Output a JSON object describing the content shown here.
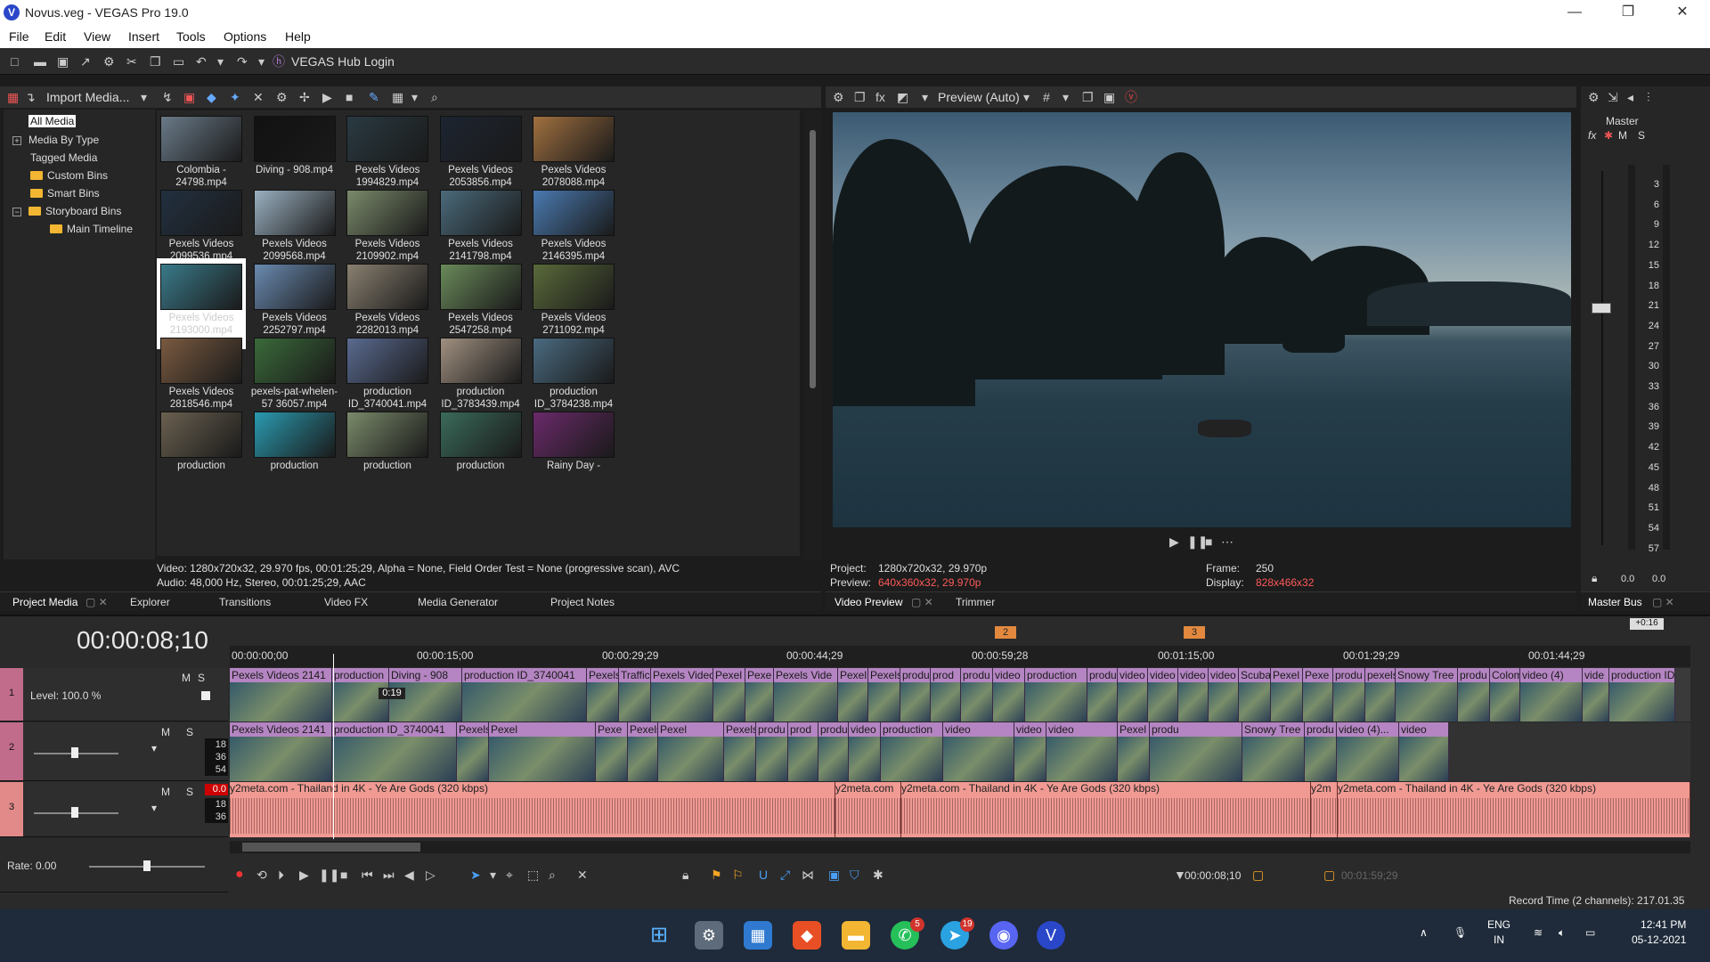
{
  "window": {
    "title": "Novus.veg - VEGAS Pro 19.0",
    "minimize": "—",
    "maximize": "❐",
    "close": "✕"
  },
  "menu": [
    "File",
    "Edit",
    "View",
    "Insert",
    "Tools",
    "Options",
    "Help"
  ],
  "toolbar": {
    "hub_login": "VEGAS Hub Login"
  },
  "media": {
    "import_label": "Import Media...",
    "tree": [
      "All Media",
      "Media By Type",
      "Tagged Media",
      "Custom Bins",
      "Smart Bins",
      "Storyboard Bins",
      "Main Timeline"
    ],
    "items": [
      {
        "label": "Colombia - 24798.mp4"
      },
      {
        "label": "Diving - 908.mp4"
      },
      {
        "label": "Pexels Videos 1994829.mp4"
      },
      {
        "label": "Pexels Videos 2053856.mp4"
      },
      {
        "label": "Pexels Videos 2078088.mp4"
      },
      {
        "label": "Pexels Videos 2099536.mp4"
      },
      {
        "label": "Pexels Videos 2099568.mp4"
      },
      {
        "label": "Pexels Videos 2109902.mp4"
      },
      {
        "label": "Pexels Videos 2141798.mp4"
      },
      {
        "label": "Pexels Videos 2146395.mp4"
      },
      {
        "label": "Pexels Videos 2193000.mp4"
      },
      {
        "label": "Pexels Videos 2252797.mp4"
      },
      {
        "label": "Pexels Videos 2282013.mp4"
      },
      {
        "label": "Pexels Videos 2547258.mp4"
      },
      {
        "label": "Pexels Videos 2711092.mp4"
      },
      {
        "label": "Pexels Videos 2818546.mp4"
      },
      {
        "label": "pexels-pat-whelen-57 36057.mp4"
      },
      {
        "label": "production ID_3740041.mp4"
      },
      {
        "label": "production ID_3783439.mp4"
      },
      {
        "label": "production ID_3784238.mp4"
      },
      {
        "label": "production"
      },
      {
        "label": "production"
      },
      {
        "label": "production"
      },
      {
        "label": "production"
      },
      {
        "label": "Rainy Day -"
      }
    ],
    "info_line1": "Video: 1280x720x32, 29.970 fps, 00:01:25;29, Alpha = None, Field Order Test = None (progressive scan), AVC",
    "info_line2": "Audio: 48,000 Hz, Stereo, 00:01:25;29, AAC",
    "tabs": [
      "Project Media",
      "Explorer",
      "Transitions",
      "Video FX",
      "Media Generator",
      "Project Notes"
    ]
  },
  "preview": {
    "mode": "Preview (Auto)",
    "project_label": "Project:",
    "project_value": "1280x720x32, 29.970p",
    "preview_label": "Preview:",
    "preview_value": "640x360x32, 29.970p",
    "frame_label": "Frame:",
    "frame_value": "250",
    "display_label": "Display:",
    "display_value": "828x466x32",
    "tabs": [
      "Video Preview",
      "Trimmer"
    ]
  },
  "master": {
    "title": "Master",
    "fx": "fx",
    "m": "M",
    "s": "S",
    "scale": [
      "3",
      "6",
      "9",
      "12",
      "15",
      "18",
      "21",
      "24",
      "27",
      "30",
      "33",
      "36",
      "39",
      "42",
      "45",
      "48",
      "51",
      "54",
      "57"
    ],
    "left": "0.0",
    "right": "0.0",
    "tab": "Master Bus",
    "offset": "+0:16"
  },
  "timeline": {
    "timecode": "00:00:08;10",
    "ruler": [
      "00:00:00;00",
      "00:00:15;00",
      "00:00:29;29",
      "00:00:44;29",
      "00:00:59;28",
      "00:01:15;00",
      "00:01:29;29",
      "00:01:44;29"
    ],
    "markers": [
      "2",
      "3"
    ],
    "track1": {
      "num": "1",
      "level": "Level: 100.0 %",
      "m": "M",
      "s": "S",
      "clips": [
        "Pexels Videos 2141",
        "production",
        "Diving - 908",
        "production ID_3740041",
        "Pexels",
        "Traffic",
        "Pexels Video",
        "Pexel",
        "Pexe",
        "Pexels Vide",
        "Pexel",
        "Pexels",
        "produ",
        "prod",
        "produ",
        "video",
        "production",
        "produ",
        "video",
        "video",
        "video",
        "video",
        "Scuba",
        "Pexel",
        "Pexe",
        "produ",
        "pexels",
        "Snowy Tree",
        "produ",
        "Colom",
        "video (4)",
        "vide",
        "production ID"
      ]
    },
    "track2": {
      "num": "2",
      "m": "M",
      "s": "S",
      "db": [
        "18",
        "36",
        "54"
      ],
      "clips": [
        "Pexels Videos 2141",
        "production ID_3740041",
        "Pexels",
        "Pexel",
        "Pexe",
        "Pexels Vide",
        "Pexel",
        "Pexels",
        "produ",
        "prod",
        "produ",
        "video",
        "production",
        "video",
        "video",
        "video",
        "Pexel",
        "produ",
        "Snowy Tree",
        "produ",
        "video (4)...",
        "video"
      ]
    },
    "track3": {
      "num": "3",
      "m": "M",
      "s": "S",
      "vol": "0.0",
      "db": [
        "18",
        "36"
      ],
      "clips": [
        "y2meta.com - Thailand in 4K - Ye Are Gods (320 kbps)",
        "y2meta.com",
        "y2meta.com - Thailand in 4K - Ye Are Gods (320 kbps)",
        "y2m",
        "y2meta.com - Thailand in 4K - Ye Are Gods (320 kbps)"
      ]
    },
    "clip_tc": "0:19",
    "rate": "Rate: 0.00",
    "cursor_tc": "00:00:08;10",
    "length_tc": "00:01:59;29",
    "record_time": "Record Time (2 channels): 217.01.35"
  },
  "taskbar": {
    "apps": [
      "windows-start",
      "settings",
      "store",
      "brave",
      "file-explorer",
      "whatsapp",
      "telegram",
      "discord",
      "vegas"
    ],
    "whatsapp_badge": "5",
    "telegram_badge": "19",
    "lang1": "ENG",
    "lang2": "IN",
    "time": "12:41 PM",
    "date": "05-12-2021"
  }
}
